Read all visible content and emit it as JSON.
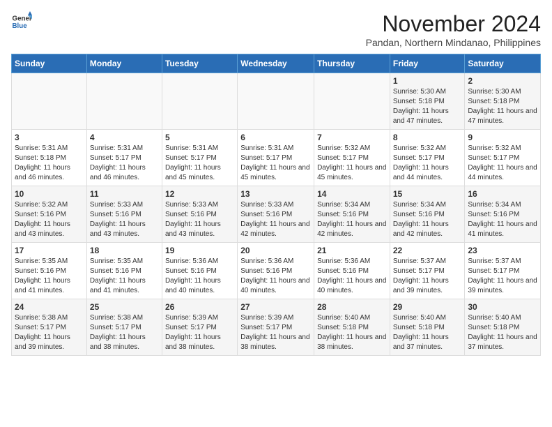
{
  "header": {
    "logo_line1": "General",
    "logo_line2": "Blue",
    "title": "November 2024",
    "subtitle": "Pandan, Northern Mindanao, Philippines"
  },
  "days_of_week": [
    "Sunday",
    "Monday",
    "Tuesday",
    "Wednesday",
    "Thursday",
    "Friday",
    "Saturday"
  ],
  "weeks": [
    [
      {
        "day": "",
        "info": ""
      },
      {
        "day": "",
        "info": ""
      },
      {
        "day": "",
        "info": ""
      },
      {
        "day": "",
        "info": ""
      },
      {
        "day": "",
        "info": ""
      },
      {
        "day": "1",
        "info": "Sunrise: 5:30 AM\nSunset: 5:18 PM\nDaylight: 11 hours and 47 minutes."
      },
      {
        "day": "2",
        "info": "Sunrise: 5:30 AM\nSunset: 5:18 PM\nDaylight: 11 hours and 47 minutes."
      }
    ],
    [
      {
        "day": "3",
        "info": "Sunrise: 5:31 AM\nSunset: 5:18 PM\nDaylight: 11 hours and 46 minutes."
      },
      {
        "day": "4",
        "info": "Sunrise: 5:31 AM\nSunset: 5:17 PM\nDaylight: 11 hours and 46 minutes."
      },
      {
        "day": "5",
        "info": "Sunrise: 5:31 AM\nSunset: 5:17 PM\nDaylight: 11 hours and 45 minutes."
      },
      {
        "day": "6",
        "info": "Sunrise: 5:31 AM\nSunset: 5:17 PM\nDaylight: 11 hours and 45 minutes."
      },
      {
        "day": "7",
        "info": "Sunrise: 5:32 AM\nSunset: 5:17 PM\nDaylight: 11 hours and 45 minutes."
      },
      {
        "day": "8",
        "info": "Sunrise: 5:32 AM\nSunset: 5:17 PM\nDaylight: 11 hours and 44 minutes."
      },
      {
        "day": "9",
        "info": "Sunrise: 5:32 AM\nSunset: 5:17 PM\nDaylight: 11 hours and 44 minutes."
      }
    ],
    [
      {
        "day": "10",
        "info": "Sunrise: 5:32 AM\nSunset: 5:16 PM\nDaylight: 11 hours and 43 minutes."
      },
      {
        "day": "11",
        "info": "Sunrise: 5:33 AM\nSunset: 5:16 PM\nDaylight: 11 hours and 43 minutes."
      },
      {
        "day": "12",
        "info": "Sunrise: 5:33 AM\nSunset: 5:16 PM\nDaylight: 11 hours and 43 minutes."
      },
      {
        "day": "13",
        "info": "Sunrise: 5:33 AM\nSunset: 5:16 PM\nDaylight: 11 hours and 42 minutes."
      },
      {
        "day": "14",
        "info": "Sunrise: 5:34 AM\nSunset: 5:16 PM\nDaylight: 11 hours and 42 minutes."
      },
      {
        "day": "15",
        "info": "Sunrise: 5:34 AM\nSunset: 5:16 PM\nDaylight: 11 hours and 42 minutes."
      },
      {
        "day": "16",
        "info": "Sunrise: 5:34 AM\nSunset: 5:16 PM\nDaylight: 11 hours and 41 minutes."
      }
    ],
    [
      {
        "day": "17",
        "info": "Sunrise: 5:35 AM\nSunset: 5:16 PM\nDaylight: 11 hours and 41 minutes."
      },
      {
        "day": "18",
        "info": "Sunrise: 5:35 AM\nSunset: 5:16 PM\nDaylight: 11 hours and 41 minutes."
      },
      {
        "day": "19",
        "info": "Sunrise: 5:36 AM\nSunset: 5:16 PM\nDaylight: 11 hours and 40 minutes."
      },
      {
        "day": "20",
        "info": "Sunrise: 5:36 AM\nSunset: 5:16 PM\nDaylight: 11 hours and 40 minutes."
      },
      {
        "day": "21",
        "info": "Sunrise: 5:36 AM\nSunset: 5:16 PM\nDaylight: 11 hours and 40 minutes."
      },
      {
        "day": "22",
        "info": "Sunrise: 5:37 AM\nSunset: 5:17 PM\nDaylight: 11 hours and 39 minutes."
      },
      {
        "day": "23",
        "info": "Sunrise: 5:37 AM\nSunset: 5:17 PM\nDaylight: 11 hours and 39 minutes."
      }
    ],
    [
      {
        "day": "24",
        "info": "Sunrise: 5:38 AM\nSunset: 5:17 PM\nDaylight: 11 hours and 39 minutes."
      },
      {
        "day": "25",
        "info": "Sunrise: 5:38 AM\nSunset: 5:17 PM\nDaylight: 11 hours and 38 minutes."
      },
      {
        "day": "26",
        "info": "Sunrise: 5:39 AM\nSunset: 5:17 PM\nDaylight: 11 hours and 38 minutes."
      },
      {
        "day": "27",
        "info": "Sunrise: 5:39 AM\nSunset: 5:17 PM\nDaylight: 11 hours and 38 minutes."
      },
      {
        "day": "28",
        "info": "Sunrise: 5:40 AM\nSunset: 5:18 PM\nDaylight: 11 hours and 38 minutes."
      },
      {
        "day": "29",
        "info": "Sunrise: 5:40 AM\nSunset: 5:18 PM\nDaylight: 11 hours and 37 minutes."
      },
      {
        "day": "30",
        "info": "Sunrise: 5:40 AM\nSunset: 5:18 PM\nDaylight: 11 hours and 37 minutes."
      }
    ]
  ]
}
